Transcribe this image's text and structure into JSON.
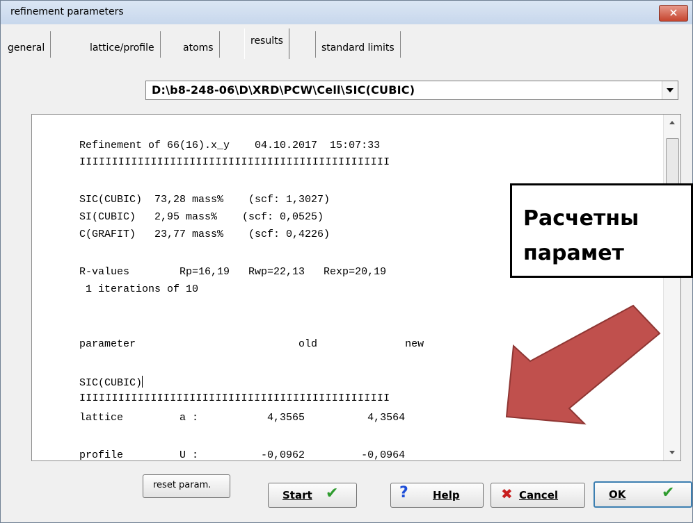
{
  "window": {
    "title": "refinement parameters",
    "close_glyph": "✕"
  },
  "tabs": [
    {
      "label": "general"
    },
    {
      "label": "lattice/profile"
    },
    {
      "label": "atoms"
    },
    {
      "label": "results",
      "active": true
    },
    {
      "label": "standard limits"
    }
  ],
  "path_combo": {
    "value": "D:\\b8-248-06\\D\\XRD\\PCW\\Cell\\SIC(CUBIC)"
  },
  "results": {
    "header": "Refinement of 66(16).x_y    04.10.2017  15:07:33",
    "divider": "IIIIIIIIIIIIIIIIIIIIIIIIIIIIIIIIIIIIIIIIIIIIIIII",
    "phases": [
      "SIC(CUBIC)  73,28 mass%    (scf: 1,3027)",
      "SI(CUBIC)   2,95 mass%    (scf: 0,0525)",
      "C(GRAFIT)   23,77 mass%    (scf: 0,4226)"
    ],
    "rvalues": "R-values        Rp=16,19   Rwp=22,13   Rexp=20,19",
    "iterations": " 1 iterations of 10",
    "param_header": "parameter                          old              new",
    "phase_name": "SIC(CUBIC)",
    "lattice_row": "lattice         a :           4,3565          4,3564",
    "profile_row": "profile         U :          -0,0962         -0,0964"
  },
  "buttons": {
    "reset": "reset param.",
    "start": "Start",
    "help": "Help",
    "cancel": "Cancel",
    "ok": "OK"
  },
  "annotation": {
    "line1": "Расчетны",
    "line2": "парамет",
    "arrow_color": "#c0504d"
  }
}
